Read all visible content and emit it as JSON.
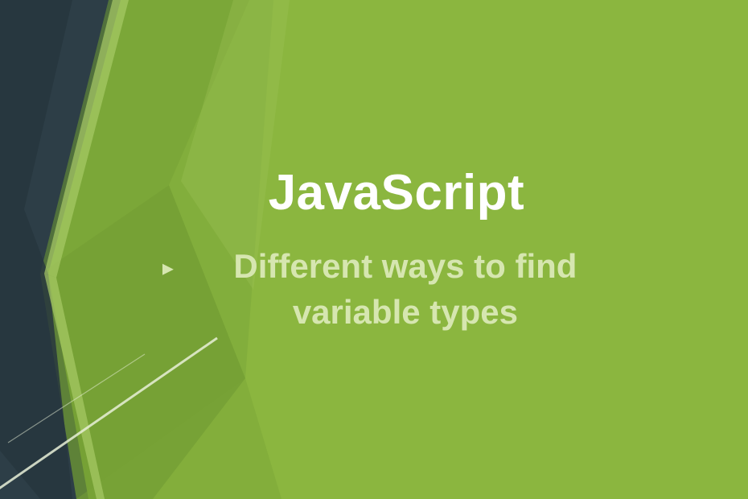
{
  "slide": {
    "title": "JavaScript",
    "subtitle": "Different ways to find variable types",
    "bullet": "▸"
  },
  "colors": {
    "background": "#8bb63f",
    "title_color": "#ffffff",
    "subtitle_color": "#d6e6b0",
    "dark_facet": "#2d3e47",
    "mid_green": "#6f9a33",
    "light_green": "#9ec455",
    "lighter_green": "#a8cb66",
    "line_accent": "#e8f0d8"
  }
}
